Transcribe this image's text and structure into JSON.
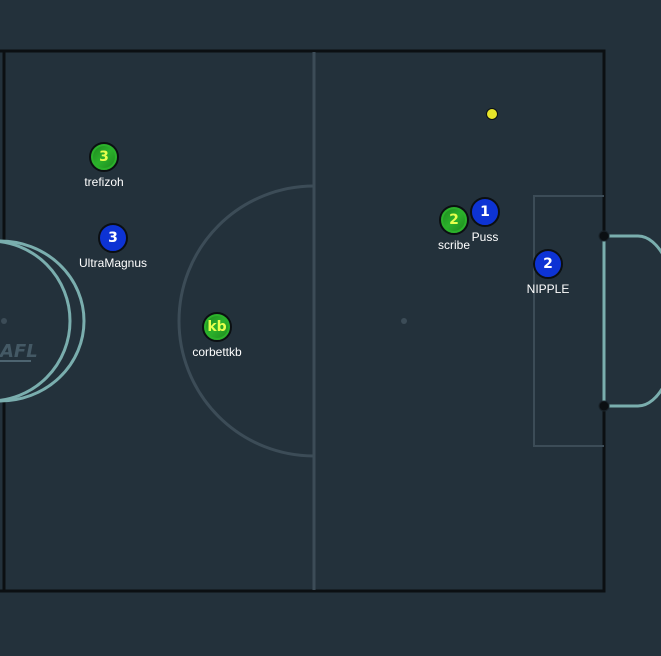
{
  "pitch": {
    "colors": {
      "background": "#23313b",
      "lines": "#3c4c57",
      "boundary": "#0b0f12",
      "goal": "#7aaeae"
    },
    "watermark": "AFL"
  },
  "ball": {
    "color": "#e7e52a"
  },
  "players": [
    {
      "id": "trefizoh",
      "team": "red",
      "number": "3",
      "name": "trefizoh"
    },
    {
      "id": "ultramagnus",
      "team": "blue",
      "number": "3",
      "name": "UltraMagnus"
    },
    {
      "id": "corbettkb",
      "team": "red",
      "number": "kb",
      "name": "corbettkb"
    },
    {
      "id": "scribe",
      "team": "red",
      "number": "2",
      "name": "scribe"
    },
    {
      "id": "puss",
      "team": "blue",
      "number": "1",
      "name": "Puss"
    },
    {
      "id": "nipple",
      "team": "blue",
      "number": "2",
      "name": "NIPPLE"
    }
  ],
  "teams": {
    "red": {
      "color": "#2bb12b",
      "text_color": "#e6ff4d"
    },
    "blue": {
      "color": "#0d33d4",
      "text_color": "#ffffff"
    }
  }
}
